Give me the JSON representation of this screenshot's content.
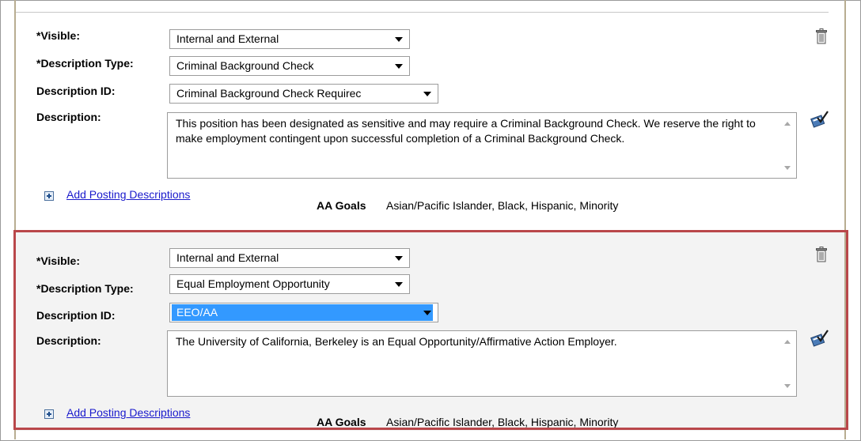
{
  "cards": [
    {
      "visible_label": "*Visible:",
      "visible_value": "Internal and External",
      "desc_type_label": "*Description Type:",
      "desc_type_value": "Criminal Background Check",
      "desc_id_label": "Description ID:",
      "desc_id_value": "Criminal Background Check Requirec",
      "description_label": "Description:",
      "description_text": "This position has been designated as sensitive and may require a Criminal Background Check. We reserve the right to make employment contingent upon successful completion of a Criminal Background Check.",
      "add_link": "Add Posting Descriptions",
      "aa_goals_label": "AA Goals",
      "aa_goals_value": "Asian/Pacific Islander, Black, Hispanic, Minority"
    },
    {
      "visible_label": "*Visible:",
      "visible_value": "Internal and External",
      "desc_type_label": "*Description Type:",
      "desc_type_value": "Equal Employment Opportunity",
      "desc_id_label": "Description ID:",
      "desc_id_value": "EEO/AA",
      "description_label": "Description:",
      "description_text": "The University of California, Berkeley is an Equal Opportunity/Affirmative Action Employer.",
      "add_link": "Add Posting Descriptions",
      "aa_goals_label": "AA Goals",
      "aa_goals_value": "Asian/Pacific Islander, Black, Hispanic, Minority"
    }
  ],
  "icons": {
    "delete": "trash-icon",
    "spellcheck": "spell-check-icon",
    "add": "plus-icon"
  },
  "colors": {
    "highlight_border": "#b9474a",
    "link": "#1a1acc",
    "selection": "#3399ff"
  }
}
